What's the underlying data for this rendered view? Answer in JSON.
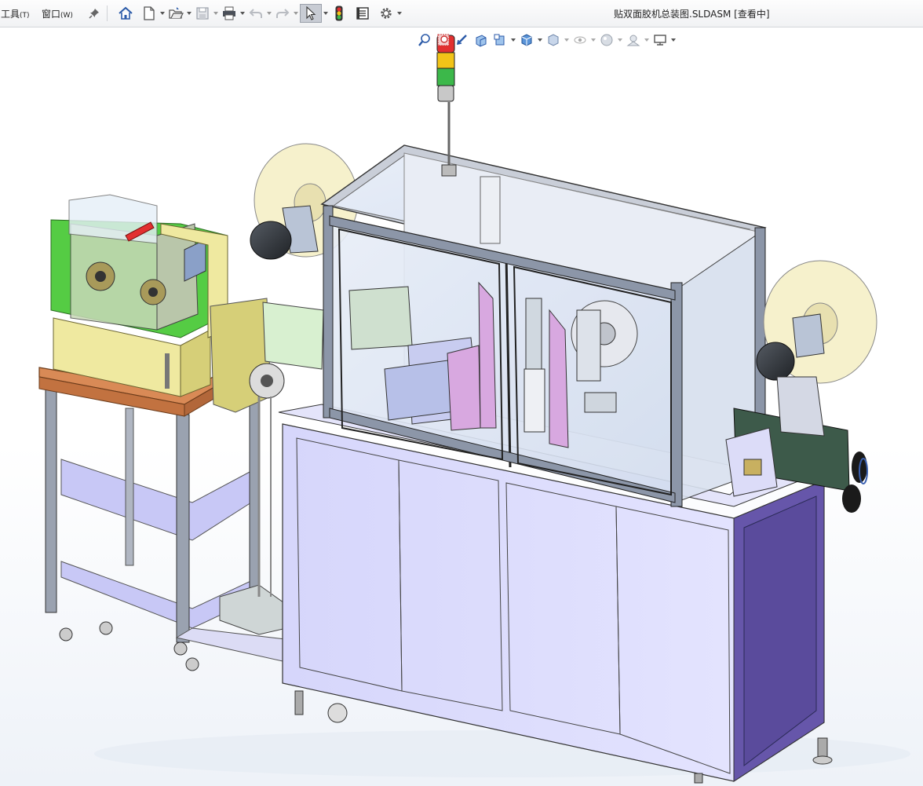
{
  "menu": {
    "tools": "工具",
    "tools_key": "(T)",
    "window": "窗口",
    "window_key": "(W)"
  },
  "window": {
    "title": "贴双面胶机总装图.SLDASM [查看中]"
  },
  "toolbar": {
    "items": [
      {
        "name": "home-icon"
      },
      {
        "name": "new-document-icon"
      },
      {
        "name": "open-folder-icon"
      },
      {
        "name": "save-icon"
      },
      {
        "name": "print-icon"
      },
      {
        "name": "undo-icon"
      },
      {
        "name": "redo-icon"
      },
      {
        "name": "select-pointer-icon"
      },
      {
        "name": "traffic-light-icon"
      },
      {
        "name": "file-properties-icon"
      },
      {
        "name": "options-gear-icon"
      }
    ]
  },
  "view_toolbar": {
    "items": [
      {
        "name": "zoom-to-fit-icon"
      },
      {
        "name": "zoom-area-icon"
      },
      {
        "name": "previous-view-icon"
      },
      {
        "name": "section-view-icon"
      },
      {
        "name": "dynamic-annotation-icon"
      },
      {
        "name": "view-orientation-icon"
      },
      {
        "name": "display-style-icon"
      },
      {
        "name": "hide-show-items-icon"
      },
      {
        "name": "edit-appearance-icon"
      },
      {
        "name": "apply-scene-icon"
      },
      {
        "name": "view-settings-icon"
      }
    ]
  },
  "colors": {
    "frame": "#8c96a8",
    "cabinet": "#dcdcff",
    "cabinet_side": "#6656aa",
    "glass": "#dfe7f4",
    "wood": "#d98a56",
    "yellow_box": "#efe9a0",
    "green_plate": "#55cc44",
    "pink_parts": "#d8a8e0",
    "dark_motor": "#2b2f35",
    "tape_roll": "#f6f1cc",
    "traffic_red": "#e23030",
    "traffic_yellow": "#f2c418",
    "traffic_green": "#3cb84a"
  }
}
